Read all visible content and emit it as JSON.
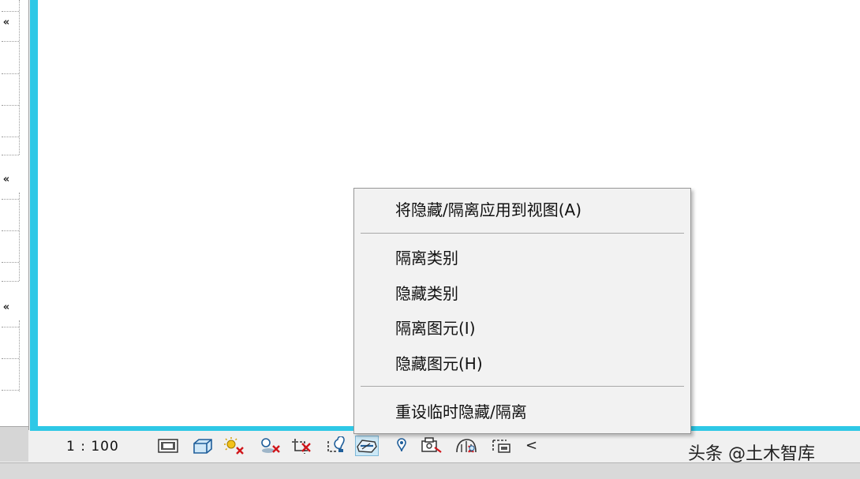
{
  "context_menu": {
    "items": [
      {
        "label": "将隐藏/隔离应用到视图(A)"
      },
      {
        "label": "隔离类别"
      },
      {
        "label": "隐藏类别"
      },
      {
        "label": "隔离图元(I)"
      },
      {
        "label": "隐藏图元(H)"
      },
      {
        "label": "重设临时隐藏/隔离"
      }
    ]
  },
  "view_bar": {
    "scale": "1 : 100",
    "icons": [
      "detail-level-icon",
      "visual-style-icon",
      "sun-path-off-icon",
      "shadows-off-icon",
      "crop-view-off-icon",
      "show-crop-region-icon",
      "temporary-hide-isolate-icon",
      "reveal-hidden-elements-icon",
      "temporary-view-properties-icon",
      "analytical-model-icon",
      "highlight-displacement-icon"
    ],
    "collapse_glyph": "<"
  },
  "left_panel": {
    "collapse_glyph": "«"
  },
  "watermark": "头条 @土木智库",
  "colors": {
    "viewport_border": "#2ec8e6",
    "menu_background": "#f2f2f2",
    "active_icon": "#cce8f6"
  }
}
